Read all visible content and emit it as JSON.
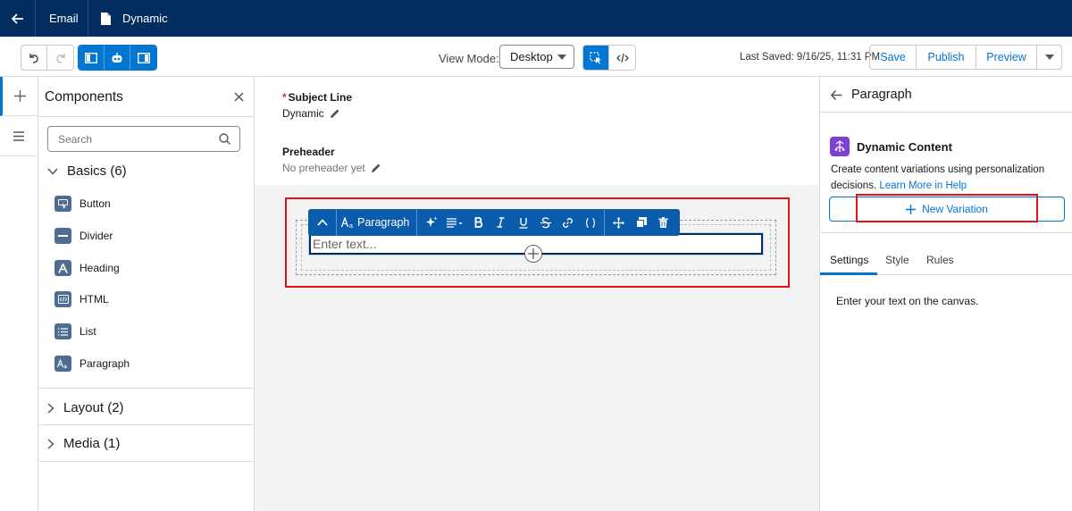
{
  "topbar": {
    "tab_email": "Email",
    "tab_dynamic": "Dynamic"
  },
  "toolbar": {
    "view_mode_label": "View Mode:",
    "view_mode_value": "Desktop",
    "last_saved": "Last Saved: 9/16/25, 11:31 PM",
    "save": "Save",
    "publish": "Publish",
    "preview": "Preview"
  },
  "components": {
    "title": "Components",
    "search_placeholder": "Search",
    "basics": "Basics (6)",
    "items": [
      "Button",
      "Divider",
      "Heading",
      "HTML",
      "List",
      "Paragraph"
    ],
    "layout": "Layout (2)",
    "media": "Media (1)"
  },
  "canvas": {
    "subject_label": "Subject Line",
    "subject_value": "Dynamic",
    "preheader_label": "Preheader",
    "preheader_value": "No preheader yet",
    "text_placeholder": "Enter text...",
    "rte_paragraph": "Paragraph",
    "rte_icons": [
      "chevron-up-icon",
      "sparkle-icon",
      "align-icon",
      "bold-icon",
      "italic-icon",
      "underline-icon",
      "strikethrough-icon",
      "link-icon",
      "merge-field-icon",
      "move-icon",
      "duplicate-icon",
      "delete-icon"
    ]
  },
  "right_panel": {
    "title": "Paragraph",
    "dynamic_title": "Dynamic Content",
    "desc": "Create content variations using personalization decisions.",
    "learn_more": "Learn More in Help",
    "new_variation": "New Variation",
    "tabs": [
      "Settings",
      "Style",
      "Rules"
    ],
    "hint": "Enter your text on the canvas."
  },
  "colors": {
    "brand_dark": "#032d60",
    "accent": "#0176d3",
    "highlight_red": "#e3131b",
    "dynamic_purple": "#7f3fd8"
  }
}
